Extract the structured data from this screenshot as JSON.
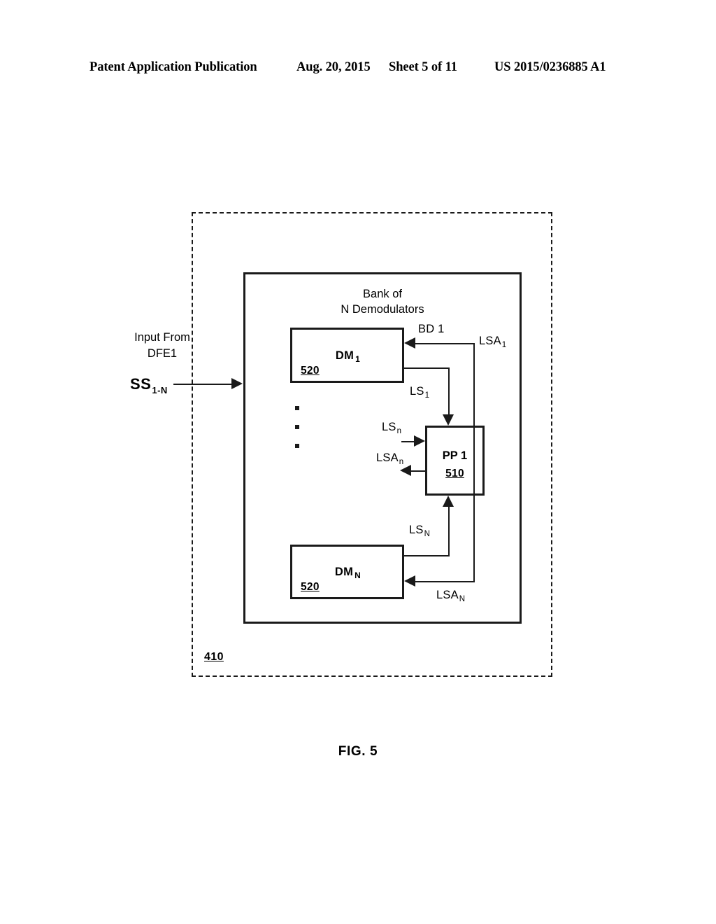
{
  "header": {
    "publication": "Patent Application Publication",
    "date": "Aug. 20, 2015",
    "sheet": "Sheet 5 of 11",
    "patent_number": "US 2015/0236885 A1"
  },
  "figure": {
    "caption": "FIG. 5",
    "outer_module_ref": "410",
    "inner_box_title": "Bank of\nN Demodulators",
    "input_text": "Input From\nDFE1",
    "input_signal": "SS",
    "input_signal_sub": "1-N"
  },
  "blocks": {
    "dm1": {
      "name": "DM",
      "name_sub": "1",
      "ref": "520"
    },
    "dmN": {
      "name": "DM",
      "name_sub": "N",
      "ref": "520"
    },
    "pp1": {
      "name": "PP 1",
      "ref": "510"
    }
  },
  "signals": {
    "bd1": {
      "text": "BD 1",
      "sub": ""
    },
    "lsa1": {
      "text": "LSA",
      "sub": "1"
    },
    "ls1": {
      "text": "LS",
      "sub": "1"
    },
    "lsn": {
      "text": "LS",
      "sub": "n"
    },
    "lsan": {
      "text": "LSA",
      "sub": "n"
    },
    "lsN": {
      "text": "LS",
      "sub": "N"
    },
    "lsaN": {
      "text": "LSA",
      "sub": "N"
    }
  },
  "colors": {
    "stroke": "#1a1a1a",
    "background": "#ffffff"
  }
}
